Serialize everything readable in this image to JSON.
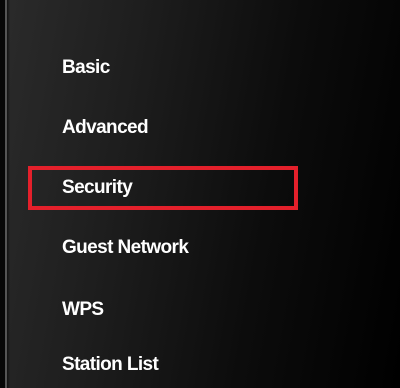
{
  "sidebar": {
    "items": [
      {
        "label": "Basic"
      },
      {
        "label": "Advanced"
      },
      {
        "label": "Security",
        "selected": true,
        "highlight_color": "#e4202b"
      },
      {
        "label": "Guest Network"
      },
      {
        "label": "WPS"
      },
      {
        "label": "Station List"
      }
    ]
  },
  "colors": {
    "text": "#ffffff",
    "background_start": "#2b2b2b",
    "background_end": "#000000",
    "highlight": "#e4202b"
  }
}
